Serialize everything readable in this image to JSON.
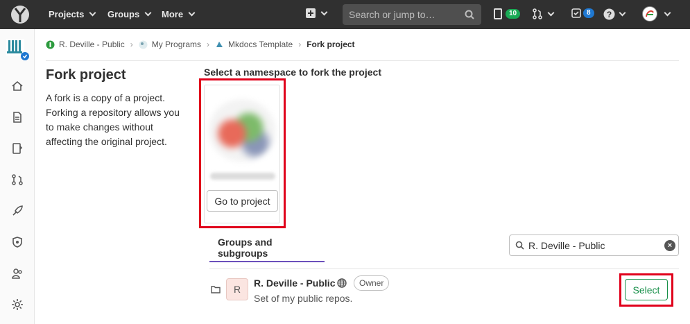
{
  "navbar": {
    "projects_label": "Projects",
    "groups_label": "Groups",
    "more_label": "More",
    "search_placeholder": "Search or jump to…",
    "issues_count": "10",
    "todos_count": "8"
  },
  "breadcrumb": {
    "items": [
      "R. Deville - Public",
      "My Programs",
      "Mkdocs Template"
    ],
    "current": "Fork project"
  },
  "page": {
    "title": "Fork project",
    "description": "A fork is a copy of a project. Forking a repository allows you to make changes without affecting the original project."
  },
  "namespace": {
    "heading": "Select a namespace to fork the project",
    "goto_button": "Go to project"
  },
  "tabs": {
    "groups": "Groups and subgroups"
  },
  "filter": {
    "value": "R. Deville - Public"
  },
  "group_row": {
    "avatar_letter": "R",
    "name": "R. Deville - Public",
    "role": "Owner",
    "description": "Set of my public repos.",
    "select_button": "Select"
  },
  "colors": {
    "navbar_bg": "#303030",
    "accent_purple": "#6b4fbb",
    "success_green": "#168f48",
    "highlight_red": "#e0001b",
    "issues_badge": "#1aaa55",
    "todos_badge": "#1f78d1"
  }
}
